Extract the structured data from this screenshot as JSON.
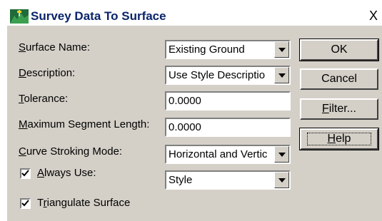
{
  "window": {
    "title": "Survey Data To Surface",
    "close_glyph": "X"
  },
  "fields": {
    "surface_name": {
      "label_u": "S",
      "label_rest": "urface Name:",
      "value": "Existing Ground"
    },
    "description": {
      "label_u": "D",
      "label_rest": "escription:",
      "value": "Use Style Descriptio"
    },
    "tolerance": {
      "label_u": "T",
      "label_rest": "olerance:",
      "value": "0.0000"
    },
    "max_segment": {
      "label_u": "M",
      "label_rest": "aximum Segment Length:",
      "value": "0.0000"
    },
    "curve_stroking": {
      "label_u": "C",
      "label_rest": "urve Stroking Mode:",
      "value": "Horizontal and Vertic"
    },
    "always_use": {
      "label_u": "A",
      "label_rest": "lways Use:",
      "checked": true,
      "value": "Style"
    },
    "triangulate": {
      "label_pre": "T",
      "label_u": "r",
      "label_rest": "iangulate Surface",
      "checked": true
    }
  },
  "buttons": {
    "ok": "OK",
    "cancel": "Cancel",
    "filter_u": "F",
    "filter_rest": "ilter...",
    "help_u": "H",
    "help_rest": "elp"
  },
  "icons": {
    "app": "survey-surface-icon",
    "dropdown": "chevron-down-icon",
    "check": "checkmark-icon"
  },
  "colors": {
    "title_text": "#0a246a",
    "dialog_bg": "#d4d0c8"
  }
}
